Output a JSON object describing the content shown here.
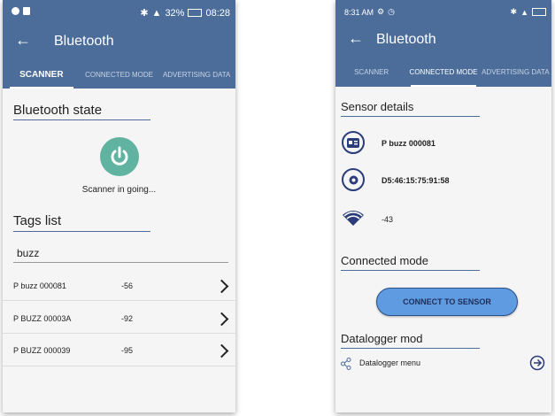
{
  "colors": {
    "header": "#4c6d9a",
    "accent_button": "#5f9be0",
    "power_icon": "#5fb3a0",
    "icon_navy": "#2a3c7a"
  },
  "left": {
    "status_time": "08:28",
    "status_battery": "32%",
    "appbar_title": "Bluetooth",
    "tabs": [
      {
        "label": "SCANNER",
        "active": true
      },
      {
        "label": "CONNECTED MODE",
        "active": false
      },
      {
        "label": "ADVERTISING DATA",
        "active": false
      }
    ],
    "bluetooth_state_title": "Bluetooth state",
    "power_icon": "power-icon",
    "scanner_status": "Scanner in going...",
    "tags_list_title": "Tags list",
    "filter_value": "buzz",
    "tags": [
      {
        "name": "P buzz 000081",
        "rssi": "-56"
      },
      {
        "name": "P BUZZ 00003A",
        "rssi": "-92"
      },
      {
        "name": "P BUZZ 000039",
        "rssi": "-95"
      }
    ]
  },
  "right": {
    "status_time": "8:31 AM",
    "appbar_title": "Bluetooth",
    "tabs": [
      {
        "label": "SCANNER",
        "active": false
      },
      {
        "label": "CONNECTED MODE",
        "active": true
      },
      {
        "label": "ADVERTISING DATA",
        "active": false
      }
    ],
    "sensor_details_title": "Sensor details",
    "sensor_name": "P buzz 000081",
    "sensor_address": "D5:46:15:75:91:58",
    "sensor_rssi": "-43",
    "connected_mode_title": "Connected mode",
    "connect_button": "CONNECT TO SENSOR",
    "datalogger_title": "Datalogger mod",
    "datalogger_menu": "Datalogger menu"
  }
}
